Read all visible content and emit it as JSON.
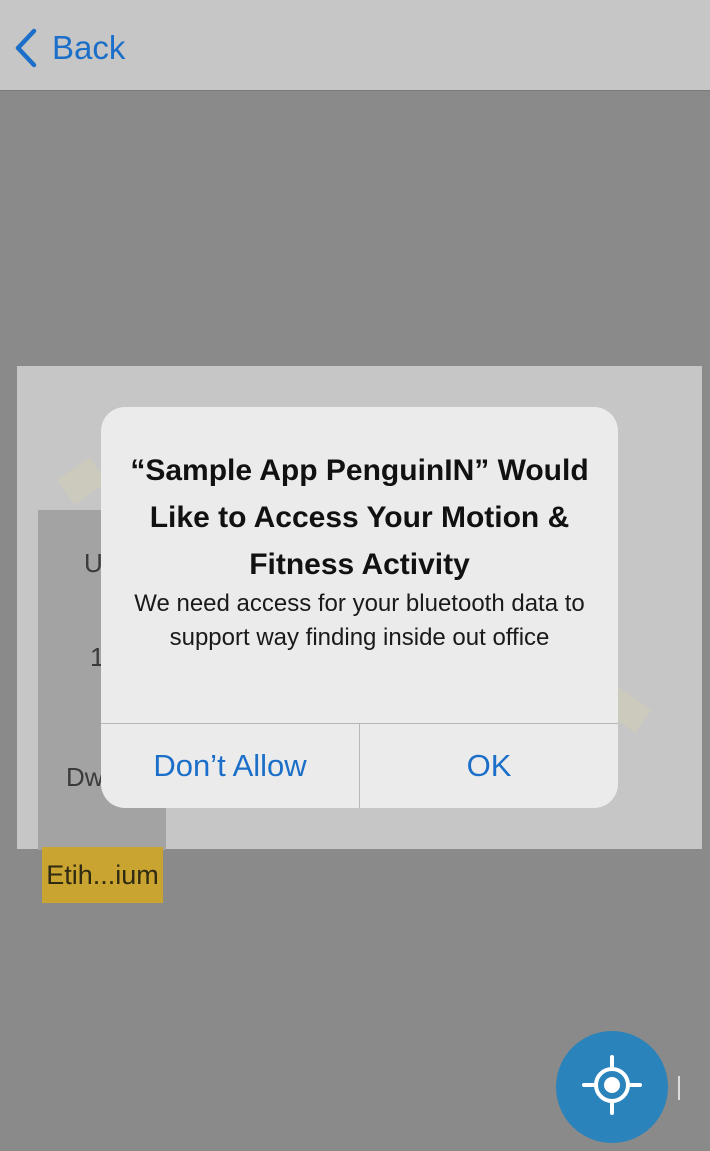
{
  "nav": {
    "back_label": "Back",
    "back_icon": "chevron-left-icon",
    "accent_color": "#1c6fc9"
  },
  "map": {
    "tile_letters": [
      "U",
      "1"
    ],
    "tile_footer": "Dw",
    "poi_label": "Etih...ium",
    "poi_color": "#c9a431"
  },
  "alert": {
    "title": "“Sample App PenguinIN” Would Like to Access Your Motion & Fitness Activity",
    "message": "We need access for your bluetooth data to support way finding inside out office",
    "dont_allow_label": "Don’t Allow",
    "ok_label": "OK"
  },
  "locate_button": {
    "icon": "crosshair-location-icon",
    "color": "#2a83ba"
  }
}
